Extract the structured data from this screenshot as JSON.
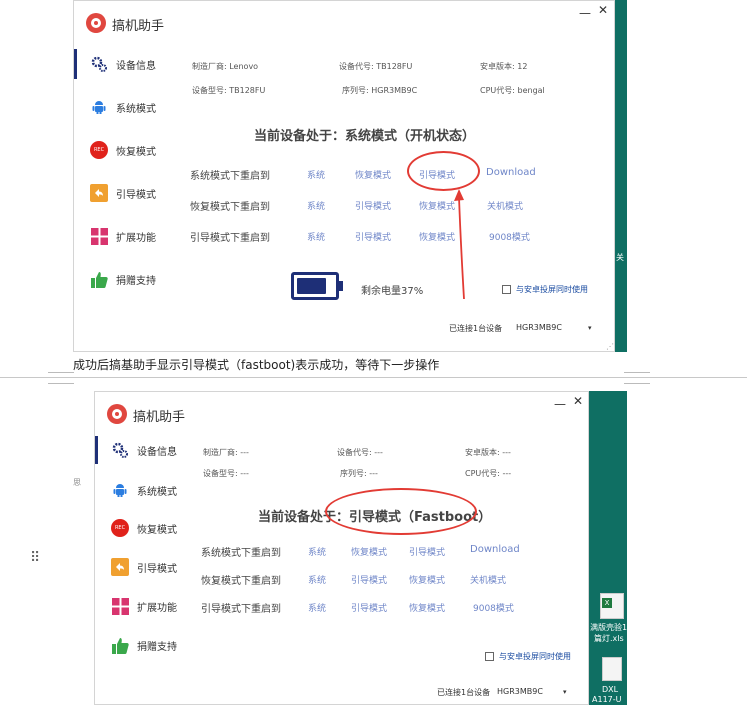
{
  "app": {
    "title": "搞机助手",
    "window_controls": {
      "minimize": "—",
      "close": "✕"
    }
  },
  "nav": [
    {
      "id": "device-info",
      "label": "设备信息",
      "icon": "gear-icon"
    },
    {
      "id": "system-mode",
      "label": "系统模式",
      "icon": "android-icon"
    },
    {
      "id": "recovery-mode",
      "label": "恢复模式",
      "icon": "rec-icon"
    },
    {
      "id": "boot-mode",
      "label": "引导模式",
      "icon": "back-arrow-icon"
    },
    {
      "id": "extensions",
      "label": "扩展功能",
      "icon": "grid-icon"
    },
    {
      "id": "donate",
      "label": "捐赠支持",
      "icon": "thumbs-up-icon"
    }
  ],
  "rec_icon_text": "REC",
  "shot1": {
    "info": {
      "manufacturer": "制造厂商: Lenovo",
      "device_code": "设备代号: TB128FU",
      "android_version": "安卓版本: 12",
      "model": "设备型号: TB128FU",
      "serial": "序列号: HGR3MB9C",
      "cpu": "CPU代号: bengal"
    },
    "state": "当前设备处于：系统模式（开机状态）",
    "battery": "剩余电量37%",
    "battery_level_percent": 37,
    "connected": "已连接1台设备",
    "device_select": "HGR3MB9C"
  },
  "shot2": {
    "info": {
      "manufacturer": "制造厂商: ---",
      "device_code": "设备代号: ---",
      "android_version": "安卓版本: ---",
      "model": "设备型号: ---",
      "serial": "序列号: ---",
      "cpu": "CPU代号: ---"
    },
    "state": "当前设备处于：引导模式（Fastboot）",
    "connected": "已连接1台设备",
    "device_select": "HGR3MB9C"
  },
  "reboot_rows": [
    {
      "label": "系统模式下重启到",
      "options": [
        "系统",
        "恢复模式",
        "引导模式",
        "Download"
      ]
    },
    {
      "label": "恢复模式下重启到",
      "options": [
        "系统",
        "引导模式",
        "恢复模式",
        "关机模式"
      ]
    },
    {
      "label": "引导模式下重启到",
      "options": [
        "系统",
        "引导模式",
        "恢复模式",
        "9008模式"
      ]
    }
  ],
  "screen_mirror": "与安卓投屏同时使用",
  "dropdown_arrow": "▾",
  "caption": "成功后搞基助手显示引导模式（fastboot)表示成功，等待下一步操作",
  "desktop": {
    "edge_text": "关",
    "side_text": "思",
    "file1_line1": "满版壳验1",
    "file1_line2": "篇灯.xls",
    "file2_line1": "DXL",
    "file2_line2": "A117-U"
  },
  "colors": {
    "accent_navy": "#1e2f77",
    "link": "#6f86c8",
    "annotation_red": "#e23b34",
    "desktop_teal": "#0f6f63"
  }
}
